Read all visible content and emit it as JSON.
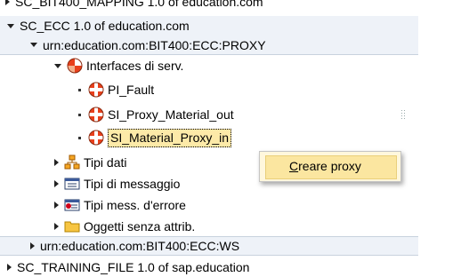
{
  "tree": {
    "top_partial": "SC_BIT400_MAPPING 1.0 of education.com",
    "sc_ecc": "SC_ECC 1.0 of education.com",
    "proxy_ns": "urn:education.com:BIT400:ECC:PROXY",
    "interfaces": "Interfaces di serv.",
    "pi_fault": "PI_Fault",
    "si_out": "SI_Proxy_Material_out",
    "si_in": "SI_Material_Proxy_in",
    "tipi_dati": "Tipi dati",
    "tipi_messaggio": "Tipi di messaggio",
    "tipi_mess_errore": "Tipi mess. d'errore",
    "oggetti": "Oggetti senza attrib.",
    "ws_ns": "urn:education.com:BIT400:ECC:WS",
    "bottom_partial": "SC_TRAINING_FILE 1.0 of sap.education"
  },
  "context_menu": {
    "create_proxy": "Creare proxy"
  },
  "icons": {
    "interface": "service-interface-icon",
    "data_type": "data-type-icon",
    "message_type": "message-type-icon",
    "fault_message": "fault-message-type-icon",
    "folder": "folder-icon"
  },
  "colors": {
    "selection": "#fdeaa8",
    "menu_bg": "#fff7dd",
    "interface_red": "#e8401c"
  }
}
